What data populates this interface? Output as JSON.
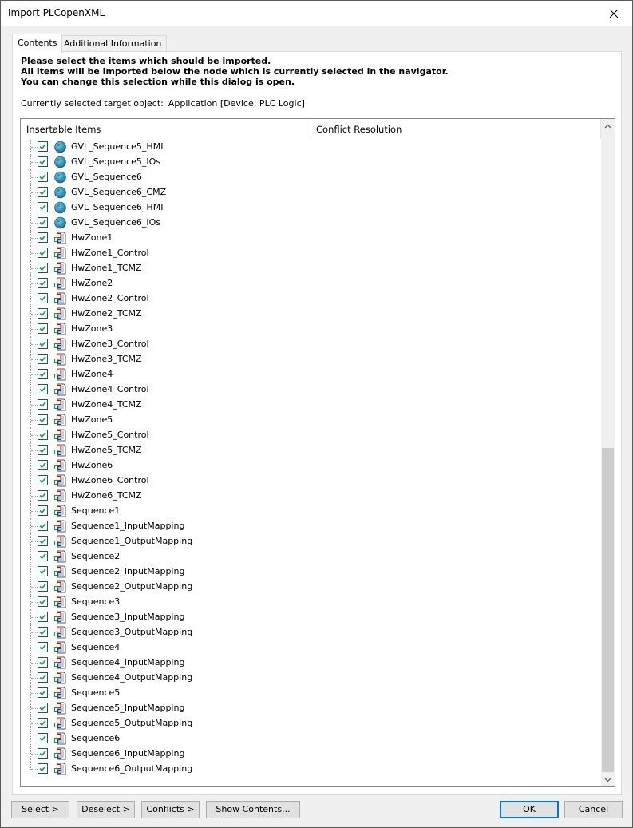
{
  "window": {
    "title": "Import PLCopenXML",
    "close_icon": "close-icon"
  },
  "tabs": [
    {
      "label": "Contents",
      "active": true
    },
    {
      "label": "Additional Information",
      "active": false
    }
  ],
  "instructions": [
    "Please select the items which should be imported.",
    "All items will be imported below the node which is currently selected in the navigator.",
    "You can change this selection while this dialog is open."
  ],
  "target": {
    "label": "Currently selected target object:",
    "value": "Application [Device: PLC Logic]"
  },
  "list": {
    "columns": [
      "Insertable Items",
      "Conflict Resolution"
    ],
    "items": [
      {
        "name": "GVL_Sequence5_HMI",
        "icon": "gvl-globe-icon",
        "checked": true,
        "conflict": ""
      },
      {
        "name": "GVL_Sequence5_IOs",
        "icon": "gvl-globe-icon",
        "checked": true,
        "conflict": ""
      },
      {
        "name": "GVL_Sequence6",
        "icon": "gvl-globe-icon",
        "checked": true,
        "conflict": ""
      },
      {
        "name": "GVL_Sequence6_CMZ",
        "icon": "gvl-globe-icon",
        "checked": true,
        "conflict": ""
      },
      {
        "name": "GVL_Sequence6_HMI",
        "icon": "gvl-globe-icon",
        "checked": true,
        "conflict": ""
      },
      {
        "name": "GVL_Sequence6_IOs",
        "icon": "gvl-globe-icon",
        "checked": true,
        "conflict": ""
      },
      {
        "name": "HwZone1",
        "icon": "pou-icon",
        "checked": true,
        "conflict": ""
      },
      {
        "name": "HwZone1_Control",
        "icon": "pou-icon",
        "checked": true,
        "conflict": ""
      },
      {
        "name": "HwZone1_TCMZ",
        "icon": "pou-icon",
        "checked": true,
        "conflict": ""
      },
      {
        "name": "HwZone2",
        "icon": "pou-icon",
        "checked": true,
        "conflict": ""
      },
      {
        "name": "HwZone2_Control",
        "icon": "pou-icon",
        "checked": true,
        "conflict": ""
      },
      {
        "name": "HwZone2_TCMZ",
        "icon": "pou-icon",
        "checked": true,
        "conflict": ""
      },
      {
        "name": "HwZone3",
        "icon": "pou-icon",
        "checked": true,
        "conflict": ""
      },
      {
        "name": "HwZone3_Control",
        "icon": "pou-icon",
        "checked": true,
        "conflict": ""
      },
      {
        "name": "HwZone3_TCMZ",
        "icon": "pou-icon",
        "checked": true,
        "conflict": ""
      },
      {
        "name": "HwZone4",
        "icon": "pou-icon",
        "checked": true,
        "conflict": ""
      },
      {
        "name": "HwZone4_Control",
        "icon": "pou-icon",
        "checked": true,
        "conflict": ""
      },
      {
        "name": "HwZone4_TCMZ",
        "icon": "pou-icon",
        "checked": true,
        "conflict": ""
      },
      {
        "name": "HwZone5",
        "icon": "pou-icon",
        "checked": true,
        "conflict": ""
      },
      {
        "name": "HwZone5_Control",
        "icon": "pou-icon",
        "checked": true,
        "conflict": ""
      },
      {
        "name": "HwZone5_TCMZ",
        "icon": "pou-icon",
        "checked": true,
        "conflict": ""
      },
      {
        "name": "HwZone6",
        "icon": "pou-icon",
        "checked": true,
        "conflict": ""
      },
      {
        "name": "HwZone6_Control",
        "icon": "pou-icon",
        "checked": true,
        "conflict": ""
      },
      {
        "name": "HwZone6_TCMZ",
        "icon": "pou-icon",
        "checked": true,
        "conflict": ""
      },
      {
        "name": "Sequence1",
        "icon": "pou-icon",
        "checked": true,
        "conflict": ""
      },
      {
        "name": "Sequence1_InputMapping",
        "icon": "pou-icon",
        "checked": true,
        "conflict": ""
      },
      {
        "name": "Sequence1_OutputMapping",
        "icon": "pou-icon",
        "checked": true,
        "conflict": ""
      },
      {
        "name": "Sequence2",
        "icon": "pou-icon",
        "checked": true,
        "conflict": ""
      },
      {
        "name": "Sequence2_InputMapping",
        "icon": "pou-icon",
        "checked": true,
        "conflict": ""
      },
      {
        "name": "Sequence2_OutputMapping",
        "icon": "pou-icon",
        "checked": true,
        "conflict": ""
      },
      {
        "name": "Sequence3",
        "icon": "pou-icon",
        "checked": true,
        "conflict": ""
      },
      {
        "name": "Sequence3_InputMapping",
        "icon": "pou-icon",
        "checked": true,
        "conflict": ""
      },
      {
        "name": "Sequence3_OutputMapping",
        "icon": "pou-icon",
        "checked": true,
        "conflict": ""
      },
      {
        "name": "Sequence4",
        "icon": "pou-icon",
        "checked": true,
        "conflict": ""
      },
      {
        "name": "Sequence4_InputMapping",
        "icon": "pou-icon",
        "checked": true,
        "conflict": ""
      },
      {
        "name": "Sequence4_OutputMapping",
        "icon": "pou-icon",
        "checked": true,
        "conflict": ""
      },
      {
        "name": "Sequence5",
        "icon": "pou-icon",
        "checked": true,
        "conflict": ""
      },
      {
        "name": "Sequence5_InputMapping",
        "icon": "pou-icon",
        "checked": true,
        "conflict": ""
      },
      {
        "name": "Sequence5_OutputMapping",
        "icon": "pou-icon",
        "checked": true,
        "conflict": ""
      },
      {
        "name": "Sequence6",
        "icon": "pou-icon",
        "checked": true,
        "conflict": ""
      },
      {
        "name": "Sequence6_InputMapping",
        "icon": "pou-icon",
        "checked": true,
        "conflict": ""
      },
      {
        "name": "Sequence6_OutputMapping",
        "icon": "pou-icon",
        "checked": true,
        "conflict": ""
      }
    ],
    "scroll_position": 1.0
  },
  "buttons": {
    "select": "Select >",
    "deselect": "Deselect >",
    "conflicts": "Conflicts >",
    "show_contents": "Show Contents...",
    "ok": "OK",
    "cancel": "Cancel"
  },
  "colors": {
    "checkmark": "#2ea44f",
    "checkbox_border": "#1c5180",
    "default_button_border": "#0078d7",
    "scroll_thumb": "#cdcdcd"
  }
}
